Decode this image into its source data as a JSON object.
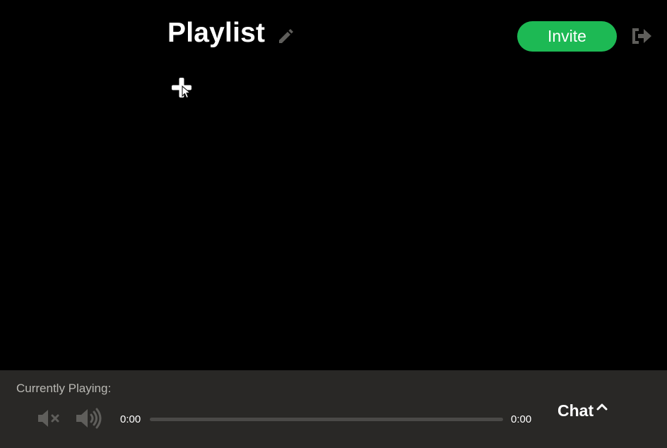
{
  "header": {
    "title": "Playlist",
    "invite_label": "Invite"
  },
  "player": {
    "now_playing_label": "Currently Playing:",
    "current_time": "0:00",
    "total_time": "0:00",
    "progress": 0
  },
  "chat": {
    "label": "Chat"
  },
  "colors": {
    "background": "#000000",
    "accent": "#1db954",
    "player_bar": "#292826",
    "icon_muted": "#5f5e5b"
  },
  "icons": {
    "edit": "pencil-icon",
    "logout": "sign-out-icon",
    "add": "plus-icon",
    "mute": "volume-mute-icon",
    "volume": "volume-up-icon",
    "chat_toggle": "chevron-up-icon"
  }
}
